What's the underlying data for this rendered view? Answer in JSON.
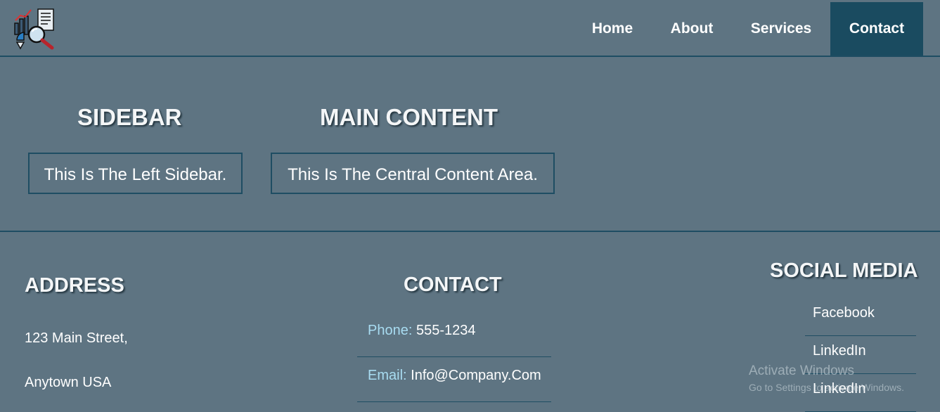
{
  "nav": {
    "items": [
      {
        "label": "Home"
      },
      {
        "label": "About"
      },
      {
        "label": "Services"
      },
      {
        "label": "Contact",
        "active": true
      }
    ]
  },
  "sidebar": {
    "title": "SIDEBAR",
    "text": "This Is The Left Sidebar."
  },
  "main": {
    "title": "MAIN CONTENT",
    "text": "This Is The Central Content Area."
  },
  "footer": {
    "address": {
      "title": "ADDRESS",
      "line1": "123 Main Street,",
      "line2": "Anytown USA"
    },
    "contact": {
      "title": "CONTACT",
      "phone_label": "Phone:",
      "phone": "555-1234",
      "email_label": "Email:",
      "email": "Info@Company.Com"
    },
    "social": {
      "title": "SOCIAL MEDIA",
      "links": [
        "Facebook",
        "LinkedIn",
        "LinkedIn"
      ]
    }
  },
  "watermark": {
    "line1": "Activate Windows",
    "line2": "Go to Settings to activate Windows."
  },
  "colors": {
    "background": "#5e7482",
    "nav_active": "#1a4b60",
    "border": "#1e4d63",
    "contact_label": "#a8dcf1"
  }
}
